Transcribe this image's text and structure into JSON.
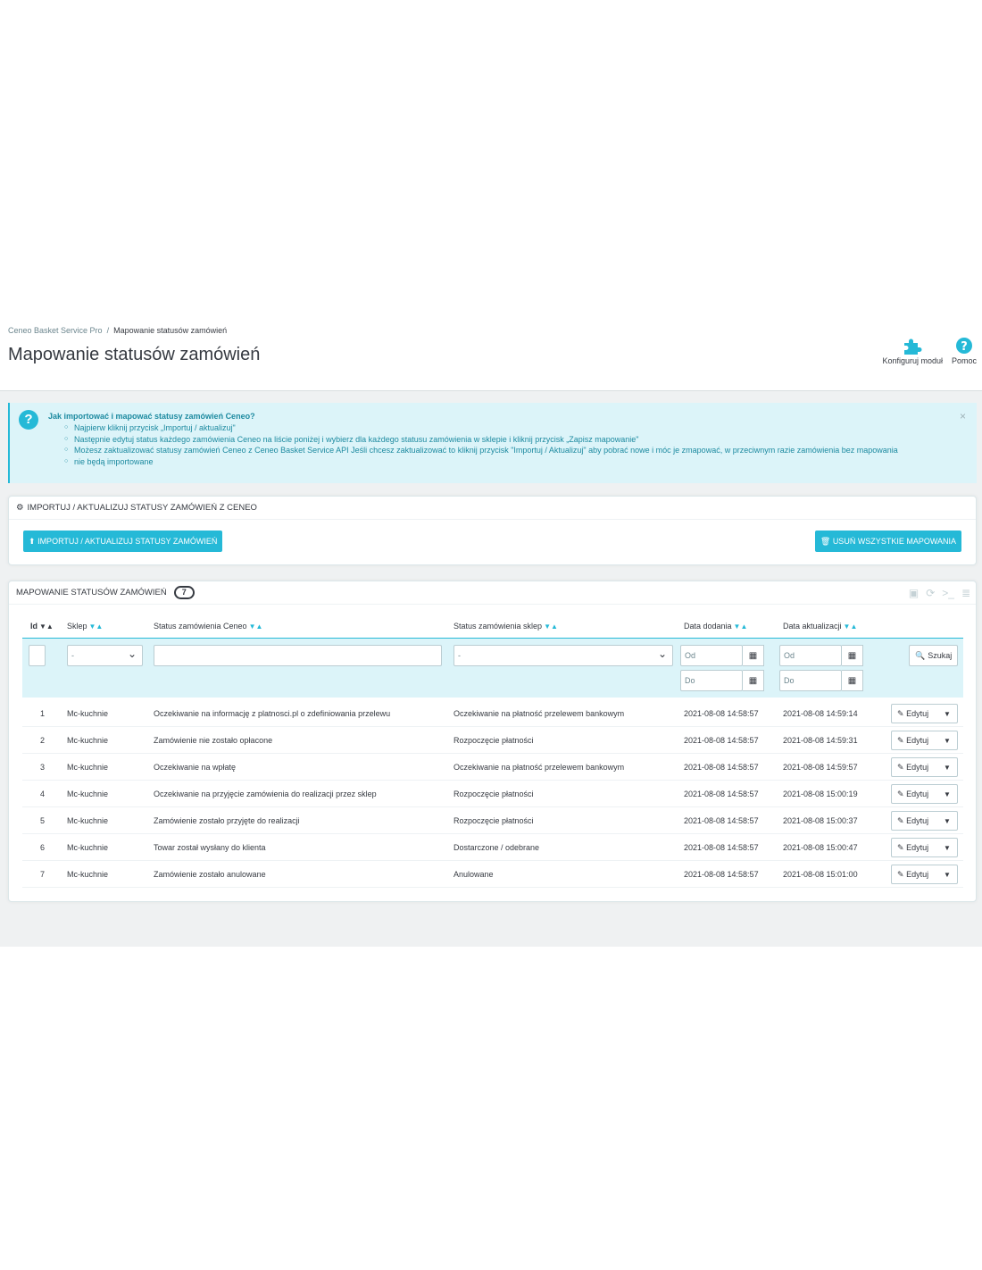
{
  "breadcrumb": {
    "parent": "Ceneo Basket Service Pro",
    "separator": "/",
    "current": "Mapowanie statusów zamówień"
  },
  "page_title": "Mapowanie statusów zamówień",
  "toolbar": {
    "configure_label": "Konfiguruj moduł",
    "help_label": "Pomoc"
  },
  "alert": {
    "title": "Jak importować i mapować statusy zamówień Ceneo?",
    "items": [
      "Najpierw kliknij przycisk „Importuj / aktualizuj\"",
      "Następnie edytuj status każdego zamówienia Ceneo na liście poniżej i wybierz dla każdego statusu zamówienia w sklepie i kliknij przycisk „Zapisz mapowanie\"",
      "Możesz zaktualizować statusy zamówień Ceneo z Ceneo Basket Service API Jeśli chcesz zaktualizować to kliknij przycisk \"Importuj / Aktualizuj\" aby pobrać nowe i móc je zmapować, w przeciwnym razie zamówienia bez mapowania",
      "nie będą importowane"
    ],
    "close": "×"
  },
  "import_panel": {
    "heading": "Importuj / aktualizuj statusy zamówień z Ceneo",
    "import_button": "Importuj / aktualizuj statusy zamówień",
    "delete_button": "Usuń wszystkie mapowania"
  },
  "list_panel": {
    "heading": "Mapowanie statusów zamówień",
    "count": "7",
    "columns": {
      "id": "Id",
      "shop": "Sklep",
      "ceneo_status": "Status zamówienia Ceneo",
      "shop_status": "Status zamówienia sklep",
      "date_add": "Data dodania",
      "date_upd": "Data aktualizacji"
    },
    "filters": {
      "shop_select": "-",
      "shop_status_select": "-",
      "from_placeholder": "Od",
      "to_placeholder": "Do",
      "search_button": "Szukaj"
    },
    "edit_label": "Edytuj",
    "rows": [
      {
        "id": "1",
        "shop": "Mc-kuchnie",
        "ceneo_status": "Oczekiwanie na informację z platnosci.pl o zdefiniowania przelewu",
        "shop_status": "Oczekiwanie na płatność przelewem bankowym",
        "date_add": "2021-08-08 14:58:57",
        "date_upd": "2021-08-08 14:59:14"
      },
      {
        "id": "2",
        "shop": "Mc-kuchnie",
        "ceneo_status": "Zamówienie nie zostało opłacone",
        "shop_status": "Rozpoczęcie płatności",
        "date_add": "2021-08-08 14:58:57",
        "date_upd": "2021-08-08 14:59:31"
      },
      {
        "id": "3",
        "shop": "Mc-kuchnie",
        "ceneo_status": "Oczekiwanie na wpłatę",
        "shop_status": "Oczekiwanie na płatność przelewem bankowym",
        "date_add": "2021-08-08 14:58:57",
        "date_upd": "2021-08-08 14:59:57"
      },
      {
        "id": "4",
        "shop": "Mc-kuchnie",
        "ceneo_status": "Oczekiwanie na przyjęcie zamówienia do realizacji przez sklep",
        "shop_status": "Rozpoczęcie płatności",
        "date_add": "2021-08-08 14:58:57",
        "date_upd": "2021-08-08 15:00:19"
      },
      {
        "id": "5",
        "shop": "Mc-kuchnie",
        "ceneo_status": "Zamówienie zostało przyjęte do realizacji",
        "shop_status": "Rozpoczęcie płatności",
        "date_add": "2021-08-08 14:58:57",
        "date_upd": "2021-08-08 15:00:37"
      },
      {
        "id": "6",
        "shop": "Mc-kuchnie",
        "ceneo_status": "Towar został wysłany do klienta",
        "shop_status": "Dostarczone / odebrane",
        "date_add": "2021-08-08 14:58:57",
        "date_upd": "2021-08-08 15:00:47"
      },
      {
        "id": "7",
        "shop": "Mc-kuchnie",
        "ceneo_status": "Zamówienie zostało anulowane",
        "shop_status": "Anulowane",
        "date_add": "2021-08-08 14:58:57",
        "date_upd": "2021-08-08 15:01:00"
      }
    ]
  },
  "icons": {
    "configure": "puzzle-icon",
    "help": "question-circle-icon",
    "alert": "question-icon",
    "import_heading": "gears-icon",
    "import_button": "upload-icon",
    "delete_button": "trash-icon",
    "calendar": "calendar-icon",
    "search": "search-icon",
    "edit": "pencil-icon"
  },
  "colors": {
    "accent": "#25b9d7",
    "alert_bg": "#dcf4f9",
    "text": "#363a41"
  }
}
